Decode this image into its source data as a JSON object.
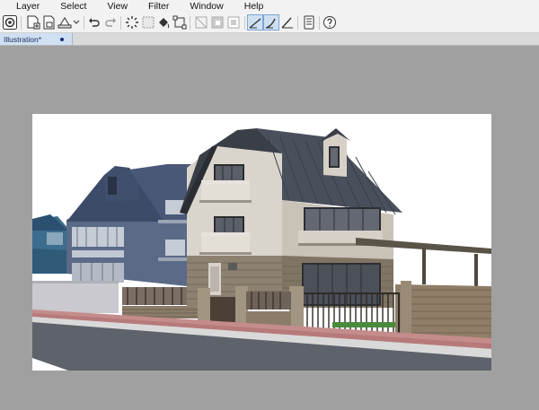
{
  "menu": {
    "items": [
      "Layer",
      "Select",
      "View",
      "Filter",
      "Window",
      "Help"
    ]
  },
  "document": {
    "tab_label": "Illustration*"
  },
  "toolbar": {
    "icons": [
      "app-menu-icon",
      "new-canvas-icon",
      "open-icon",
      "save-icon",
      "dropdown-icon",
      "undo-icon",
      "redo-icon",
      "loading-icon",
      "select-all-icon",
      "fill-icon",
      "transform-icon",
      "clear-icon",
      "clear-outside-icon",
      "fill-layer-icon",
      "ruler-icon",
      "snap-ruler-icon",
      "perspective-icon",
      "tablet-icon",
      "help-icon"
    ]
  },
  "colors": {
    "accent": "#2b4d9a",
    "tab_bg": "#cfe0f2",
    "workspace": "#a0a0a0"
  }
}
